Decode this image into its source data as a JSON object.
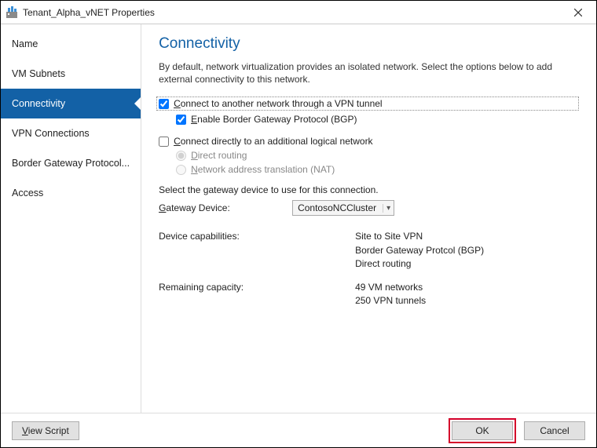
{
  "window": {
    "title": "Tenant_Alpha_vNET Properties"
  },
  "sidebar": {
    "items": [
      {
        "label": "Name",
        "selected": false
      },
      {
        "label": "VM Subnets",
        "selected": false
      },
      {
        "label": "Connectivity",
        "selected": true
      },
      {
        "label": "VPN Connections",
        "selected": false
      },
      {
        "label": "Border Gateway Protocol...",
        "selected": false
      },
      {
        "label": "Access",
        "selected": false
      }
    ]
  },
  "content": {
    "heading": "Connectivity",
    "intro": "By default, network virtualization provides an isolated network. Select the options below to add external connectivity to this network.",
    "vpn_checkbox": {
      "checked": true,
      "prefix": "C",
      "rest": "onnect to another network through a VPN tunnel"
    },
    "bgp_checkbox": {
      "checked": true,
      "prefix": "E",
      "rest": "nable Border Gateway Protocol (BGP)"
    },
    "direct_checkbox": {
      "checked": false,
      "prefix": "C",
      "rest": "onnect directly to an additional logical network"
    },
    "radio_direct": {
      "checked": true,
      "prefix": "D",
      "rest": "irect routing"
    },
    "radio_nat": {
      "checked": false,
      "prefix": "N",
      "rest": "etwork address translation (NAT)"
    },
    "gateway_prompt": "Select the gateway device to use for this connection.",
    "gateway_label_prefix": "G",
    "gateway_label_rest": "ateway Device:",
    "gateway_value": "ContosoNCCluster",
    "caps_label": "Device capabilities:",
    "caps_values": [
      "Site to Site VPN",
      "Border Gateway Protcol (BGP)",
      "Direct routing"
    ],
    "remaining_label": "Remaining capacity:",
    "remaining_values": [
      "49 VM networks",
      "250 VPN tunnels"
    ]
  },
  "footer": {
    "view_script_prefix": "V",
    "view_script_rest": "iew Script",
    "ok": "OK",
    "cancel": "Cancel"
  }
}
